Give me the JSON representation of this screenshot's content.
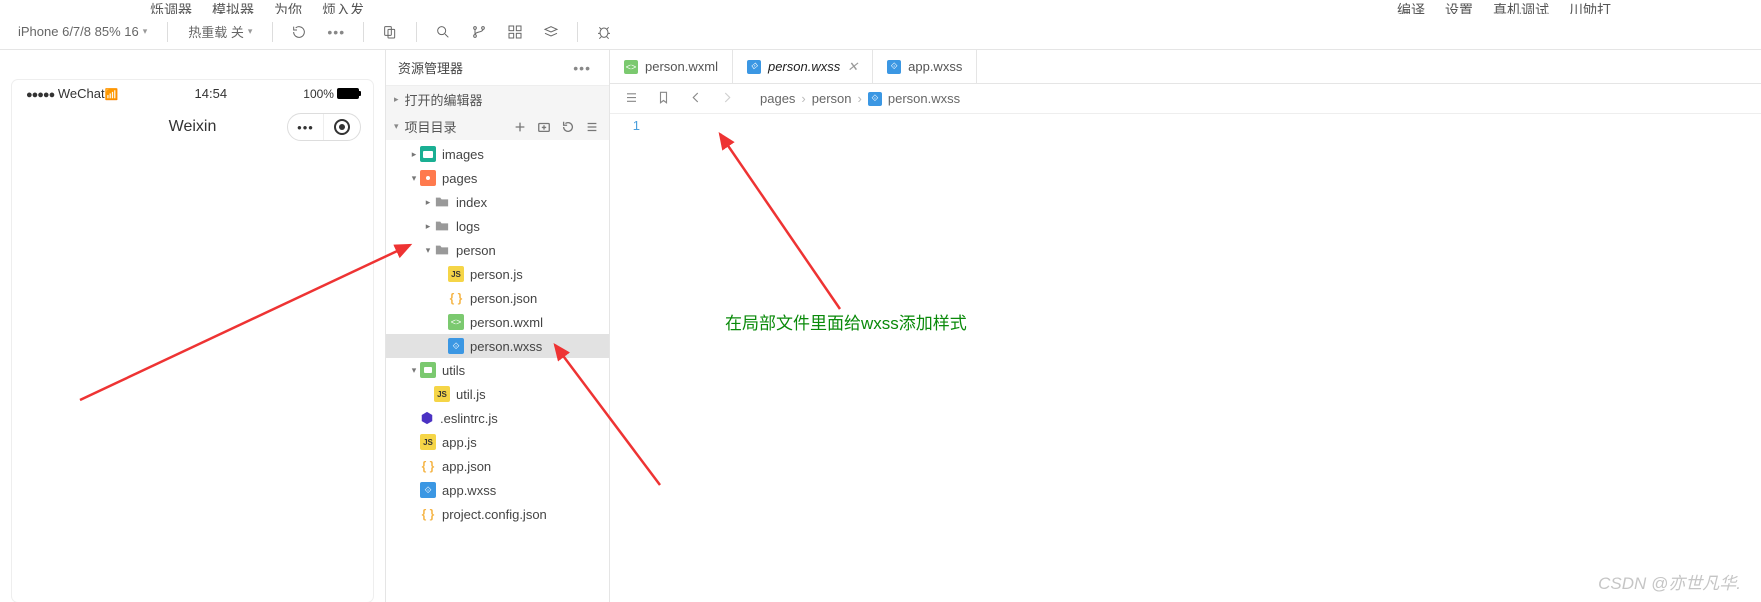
{
  "top_menu_left": [
    "烁调器",
    "模拟器",
    "为你",
    "烦入发"
  ],
  "top_menu_right": [
    "编译",
    "设置",
    "真机调试",
    "川劬打"
  ],
  "toolbar": {
    "device": "iPhone 6/7/8 85% 16",
    "hotreload": "热重载 关"
  },
  "simulator": {
    "carrier": "WeChat",
    "time": "14:54",
    "battery": "100%",
    "title": "Weixin"
  },
  "explorer": {
    "title": "资源管理器",
    "open_editors": "打开的编辑器",
    "project_dir": "项目目录",
    "tree": [
      {
        "label": "images",
        "icon": "folder-img",
        "depth": 1,
        "chev": "▸"
      },
      {
        "label": "pages",
        "icon": "folder-pages",
        "depth": 1,
        "chev": "▾"
      },
      {
        "label": "index",
        "icon": "folder",
        "depth": 2,
        "chev": "▸"
      },
      {
        "label": "logs",
        "icon": "folder",
        "depth": 2,
        "chev": "▸"
      },
      {
        "label": "person",
        "icon": "folder",
        "depth": 2,
        "chev": "▾"
      },
      {
        "label": "person.js",
        "icon": "js",
        "depth": 3
      },
      {
        "label": "person.json",
        "icon": "json",
        "depth": 3
      },
      {
        "label": "person.wxml",
        "icon": "wxml",
        "depth": 3
      },
      {
        "label": "person.wxss",
        "icon": "wxss",
        "depth": 3,
        "selected": true
      },
      {
        "label": "utils",
        "icon": "folder-utils",
        "depth": 1,
        "chev": "▾"
      },
      {
        "label": "util.js",
        "icon": "js",
        "depth": 2
      },
      {
        "label": ".eslintrc.js",
        "icon": "eslint",
        "depth": 1
      },
      {
        "label": "app.js",
        "icon": "js",
        "depth": 1
      },
      {
        "label": "app.json",
        "icon": "json",
        "depth": 1
      },
      {
        "label": "app.wxss",
        "icon": "wxss",
        "depth": 1
      },
      {
        "label": "project.config.json",
        "icon": "json",
        "depth": 1
      }
    ]
  },
  "tabs": [
    {
      "label": "person.wxml",
      "icon": "wxml",
      "active": false
    },
    {
      "label": "person.wxss",
      "icon": "wxss",
      "active": true
    },
    {
      "label": "app.wxss",
      "icon": "wxss",
      "active": false
    }
  ],
  "breadcrumb": [
    "pages",
    "person",
    "person.wxss"
  ],
  "gutter_line": "1",
  "annotation_text": "在局部文件里面给wxss添加样式",
  "watermark": "CSDN @亦世凡华."
}
